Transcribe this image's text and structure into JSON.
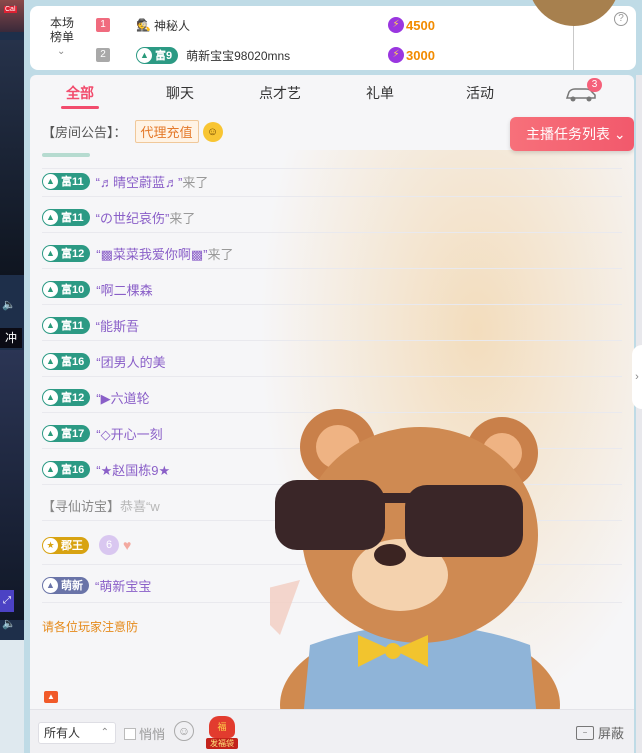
{
  "left_strip": {
    "tag": "Cal",
    "chong": "冲",
    "volume_icon": "volume-icon",
    "expand_icon": "expand-icon"
  },
  "rank": {
    "title": "本场榜单",
    "rows": [
      {
        "rank": "1",
        "name": "神秘人",
        "icon": "mystery-person-icon",
        "score": "4500",
        "medal": ""
      },
      {
        "rank": "2",
        "name": "萌新宝宝98020mns",
        "icon": "",
        "score": "3000",
        "medal": "富9"
      }
    ],
    "help": "?"
  },
  "tabs": [
    {
      "label": "全部",
      "active": true
    },
    {
      "label": "聊天",
      "active": false
    },
    {
      "label": "点才艺",
      "active": false
    },
    {
      "label": "礼单",
      "active": false
    },
    {
      "label": "活动",
      "active": false
    }
  ],
  "car_badge": "3",
  "notice": {
    "label": "【房间公告】：",
    "chip": "代理充值"
  },
  "task_button": "主播任务列表",
  "chat": [
    {
      "medal": "富11",
      "name": "“♬晴空蔚蓝♬”",
      "suffix": "来了"
    },
    {
      "medal": "富11",
      "name": "“の世纪哀伤”",
      "suffix": "来了"
    },
    {
      "medal": "富12",
      "name": "“▩菜菜我爱你啊▩”",
      "suffix": "来了"
    },
    {
      "medal": "富10",
      "name": "“啊二棵森",
      "suffix": ""
    },
    {
      "medal": "富11",
      "name": "“能斯吾",
      "suffix": ""
    },
    {
      "medal": "富16",
      "name": "“团男人的美",
      "suffix": ""
    },
    {
      "medal": "富12",
      "name": "“▶六道轮",
      "suffix": ""
    },
    {
      "medal": "富17",
      "name": "“◇开心一刻",
      "suffix": ""
    },
    {
      "medal": "富16",
      "name": "“★赵国栋9★",
      "suffix": ""
    }
  ],
  "xunxian": {
    "label": "【寻仙访宝】",
    "text": "恭喜“w"
  },
  "junwang": {
    "medal": "郡王",
    "level": "6"
  },
  "mengxin": {
    "medal": "萌新",
    "name": "“萌新宝宝"
  },
  "warning": "请各位玩家注意防",
  "footer": {
    "select": "所有人",
    "quiet": "悄悄",
    "fudai": "发福袋",
    "shield": "屏蔽"
  }
}
